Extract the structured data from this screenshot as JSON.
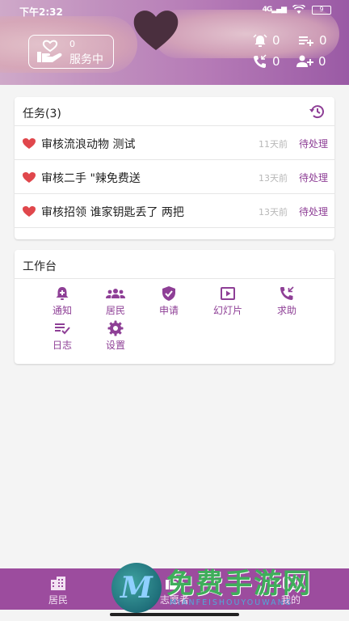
{
  "status_bar": {
    "time": "下午2:32",
    "signal": "4G",
    "battery": "9"
  },
  "header": {
    "service_count": "0",
    "service_label": "服务中",
    "stats": [
      {
        "icon": "alarm-icon",
        "value": "0"
      },
      {
        "icon": "playlist-add-icon",
        "value": "0"
      },
      {
        "icon": "phone-callback-icon",
        "value": "0"
      },
      {
        "icon": "group-add-icon",
        "value": "0"
      }
    ]
  },
  "tasks": {
    "title": "任务(3)",
    "items": [
      {
        "title": "审核流浪动物 测试",
        "age": "11天前",
        "status": "待处理"
      },
      {
        "title": "审核二手 \"辣免费送",
        "age": "13天前",
        "status": "待处理"
      },
      {
        "title": "审核招领 谁家钥匙丢了 两把",
        "age": "13天前",
        "status": "待处理"
      }
    ]
  },
  "workbench": {
    "title": "工作台",
    "items": [
      {
        "label": "通知",
        "icon": "notification-icon"
      },
      {
        "label": "居民",
        "icon": "residents-icon"
      },
      {
        "label": "申请",
        "icon": "shield-check-icon"
      },
      {
        "label": "幻灯片",
        "icon": "slideshow-icon"
      },
      {
        "label": "求助",
        "icon": "phone-help-icon"
      },
      {
        "label": "日志",
        "icon": "log-icon"
      },
      {
        "label": "设置",
        "icon": "gear-icon"
      }
    ]
  },
  "bottom_nav": {
    "items": [
      {
        "label": "居民",
        "icon": "building-icon"
      },
      {
        "label": "志愿者",
        "icon": "volunteer-icon"
      },
      {
        "label": "我的",
        "icon": "profile-icon"
      }
    ]
  },
  "watermark": {
    "logo_letter": "M",
    "title": "免费手游网",
    "subtitle": "MIANFEISHOUYOUWANG"
  },
  "colors": {
    "accent": "#8e3f96",
    "nav_bg": "#9c4c9e",
    "heart": "#e0474c"
  }
}
